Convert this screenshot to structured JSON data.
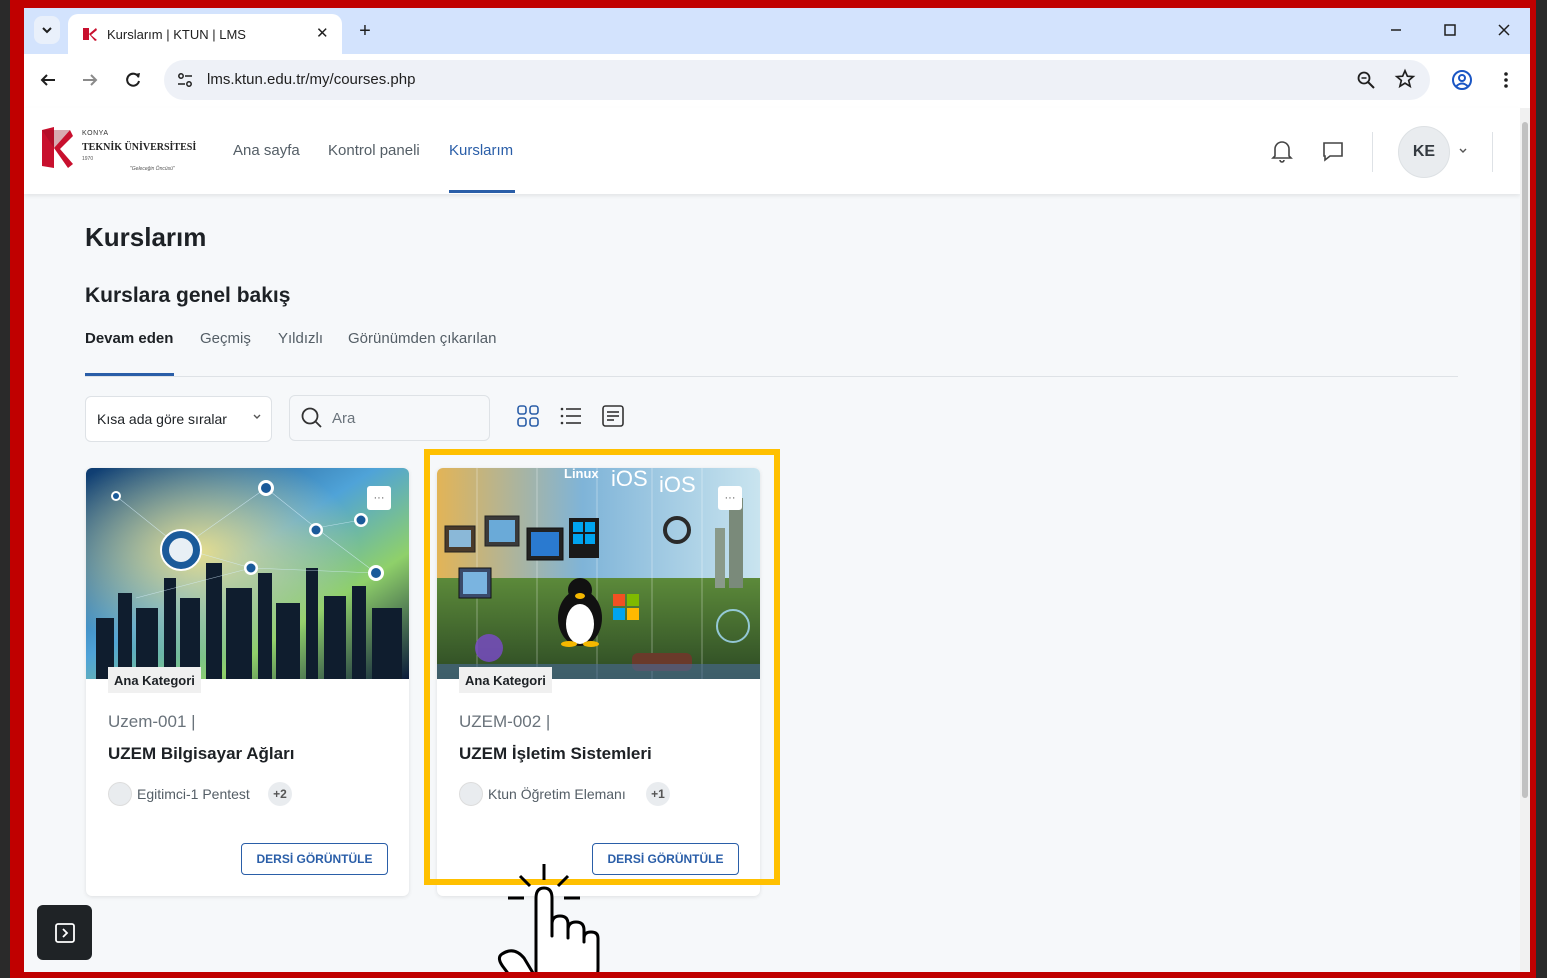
{
  "browser": {
    "tab_title": "Kurslarım | KTUN | LMS",
    "url": "lms.ktun.edu.tr/my/courses.php",
    "new_tab_glyph": "+",
    "close_glyph": "✕"
  },
  "site": {
    "logo": {
      "line1": "KONYA",
      "line2": "TEKNİK ÜNİVERSİTESİ",
      "line3": "1970",
      "line4": "\"Geleceğin Öncüsü\""
    },
    "nav": {
      "home": "Ana sayfa",
      "dashboard": "Kontrol paneli",
      "my_courses": "Kurslarım"
    },
    "user_initials": "KE",
    "accent_color": "#2a5ea8"
  },
  "main": {
    "page_title": "Kurslarım",
    "block_title": "Kurslara genel bakış",
    "filter_tabs": {
      "in_progress": "Devam eden",
      "past": "Geçmiş",
      "starred": "Yıldızlı",
      "hidden": "Görünümden çıkarılan"
    },
    "sort_label": "Kısa ada göre sıralar",
    "search_placeholder": "Ara"
  },
  "courses": [
    {
      "category": "Ana Kategori",
      "short_name": "Uzem-001 |",
      "full_name": "UZEM Bilgisayar Ağları",
      "teacher": "Egitimci-1 Pentest",
      "extra_teachers": "+2",
      "button": "DERSİ GÖRÜNTÜLE",
      "menu_glyph": "···"
    },
    {
      "category": "Ana Kategori",
      "short_name": "UZEM-002 |",
      "full_name": "UZEM İşletim Sistemleri",
      "teacher": "Ktun Öğretim Elemanı",
      "extra_teachers": "+1",
      "button": "DERSİ GÖRÜNTÜLE",
      "menu_glyph": "···",
      "image_labels": [
        "Linux",
        "iOS",
        "iOS"
      ]
    }
  ],
  "highlight_color": "#ffc000"
}
